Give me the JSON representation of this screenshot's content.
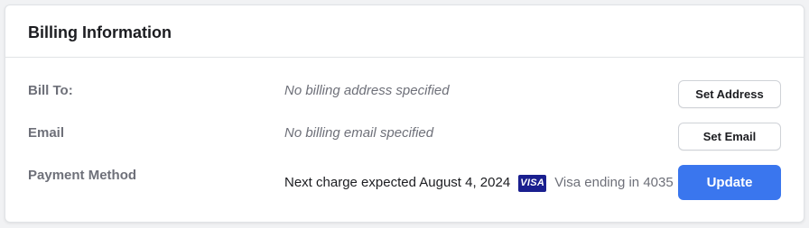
{
  "title": "Billing Information",
  "rows": {
    "bill_to": {
      "label": "Bill To:",
      "value": "No billing address specified",
      "button": "Set Address"
    },
    "email": {
      "label": "Email",
      "value": "No billing email specified",
      "button": "Set Email"
    },
    "payment": {
      "label": "Payment Method",
      "next_charge": "Next charge expected August 4, 2024",
      "card_brand": "VISA",
      "card_ending": "Visa ending in 4035",
      "button": "Update"
    }
  },
  "colors": {
    "accent": "#3a76ee",
    "visa_badge": "#1a1f8f"
  }
}
